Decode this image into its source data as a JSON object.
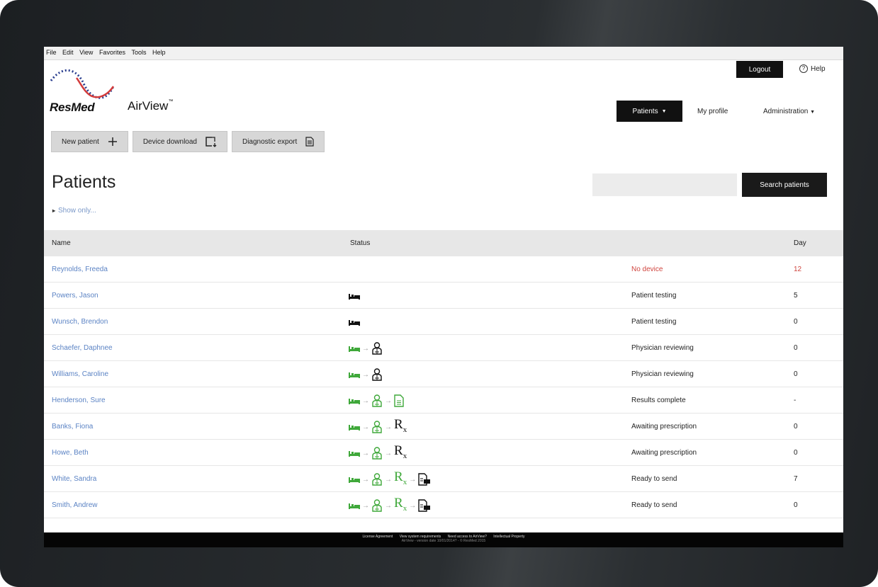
{
  "menu": [
    "File",
    "Edit",
    "View",
    "Favorites",
    "Tools",
    "Help"
  ],
  "brand": "ResMed",
  "product": "AirView",
  "product_mark": "™",
  "header": {
    "logout": "Logout",
    "help": "Help"
  },
  "nav": {
    "patients": "Patients",
    "profile": "My profile",
    "administration": "Administration"
  },
  "actions": {
    "new_patient": "New patient",
    "device_download": "Device download",
    "diagnostic_export": "Diagnostic export"
  },
  "page": {
    "title": "Patients",
    "show_only": "Show only..."
  },
  "search": {
    "button": "Search patients",
    "placeholder": ""
  },
  "table": {
    "headers": {
      "name": "Name",
      "status": "Status",
      "day": "Day"
    },
    "rows": [
      {
        "name": "Reynolds, Freeda",
        "status": "No device",
        "day": "12",
        "stage": 0
      },
      {
        "name": "Powers, Jason",
        "status": "Patient testing",
        "day": "5",
        "stage": 1
      },
      {
        "name": "Wunsch, Brendon",
        "status": "Patient testing",
        "day": "0",
        "stage": 1
      },
      {
        "name": "Schaefer, Daphnee",
        "status": "Physician reviewing",
        "day": "0",
        "stage": 2
      },
      {
        "name": "Williams, Caroline",
        "status": "Physician reviewing",
        "day": "0",
        "stage": 2
      },
      {
        "name": "Henderson, Sure",
        "status": "Results complete",
        "day": "-",
        "stage": 3
      },
      {
        "name": "Banks, Fiona",
        "status": "Awaiting prescription",
        "day": "0",
        "stage": 4
      },
      {
        "name": "Howe, Beth",
        "status": "Awaiting prescription",
        "day": "0",
        "stage": 4
      },
      {
        "name": "White, Sandra",
        "status": "Ready to send",
        "day": "7",
        "stage": 5
      },
      {
        "name": "Smith, Andrew",
        "status": "Ready to send",
        "day": "0",
        "stage": 5
      }
    ]
  },
  "footer": {
    "links": [
      "License Agreement",
      "View system requirements",
      "Need access to AirView?",
      "Intellectual Property"
    ],
    "copyright": "AirView - version date 10/01/2014? - © ResMed 2015"
  },
  "colors": {
    "link": "#5b83c4",
    "alert": "#d0453f",
    "complete": "#3fa83a",
    "dark": "#111111",
    "button": "#d7d7d7"
  }
}
